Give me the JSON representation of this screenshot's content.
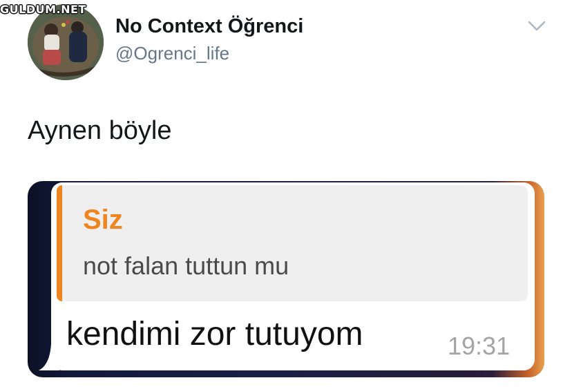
{
  "watermark": {
    "text": "GULDUM.NET"
  },
  "tweet": {
    "author": {
      "display_name": "No Context Öğrenci",
      "handle": "@Ogrenci_life"
    },
    "text": "Aynen böyle",
    "menu_icon": "chevron-down-icon"
  },
  "chat": {
    "quoted": {
      "author": "Siz",
      "text": "not falan tuttun mu",
      "accent_color": "#f0851f"
    },
    "reply": {
      "text": "kendimi zor tutuyom",
      "time": "19:31"
    }
  },
  "colors": {
    "name": "#14171a",
    "handle": "#657786",
    "timestamp": "#a4a4a4"
  }
}
